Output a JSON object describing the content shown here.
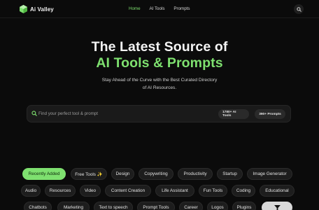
{
  "header": {
    "brand": "Ai Valley",
    "nav": [
      "Home",
      "AI Tools",
      "Prompts"
    ],
    "active_nav": "Home"
  },
  "hero": {
    "title_line1": "The Latest Source of",
    "title_line2": "AI Tools & Prompts",
    "subtitle_line1": "Stay Ahead of the Curve with the Best Curated Directory",
    "subtitle_line2": "of AI Resources."
  },
  "search": {
    "placeholder": "Find your perfect tool & prompt",
    "badge_tools": "1780+ AI Tools",
    "badge_prompts": "390+ Prompts"
  },
  "categories": {
    "row1": [
      "Recently Added",
      "Free Tools ✨",
      "Design",
      "Copywriting",
      "Productivity",
      "Startup",
      "Image Generator"
    ],
    "row2": [
      "Audio",
      "Resources",
      "Video",
      "Content Creation",
      "Life Assistant",
      "Fun Tools",
      "Coding",
      "Educational"
    ],
    "row3": [
      "Chatbots",
      "Marketing",
      "Text to speech",
      "Prompt Tools",
      "Career",
      "Logos",
      "Plugins"
    ],
    "active": "Recently Added"
  },
  "colors": {
    "accent": "#7ee06f",
    "background": "#0b0b0b"
  },
  "icons": {
    "logo": "cube-logo-icon",
    "search": "search-icon",
    "more": "filter-icon"
  }
}
